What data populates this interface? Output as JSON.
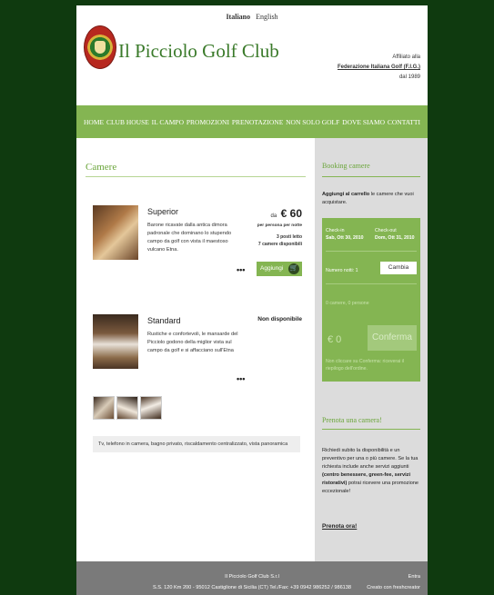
{
  "header": {
    "languages": [
      {
        "label": "Italiano",
        "active": true
      },
      {
        "label": "English",
        "active": false
      }
    ],
    "club_name": "Il Picciolo Golf Club",
    "affiliation_line1": "Affiliato alla",
    "affiliation_federation": "Federazione Italiana Golf  (F.I.G.)",
    "affiliation_since": "dal 1989"
  },
  "nav": {
    "items": [
      {
        "label": "HOME"
      },
      {
        "label": "CLUB HOUSE"
      },
      {
        "label": "IL CAMPO"
      },
      {
        "label": "PROMOZIONI"
      },
      {
        "label": "PRENOTAZIONE"
      },
      {
        "label": "NON SOLO GOLF"
      },
      {
        "label": "DOVE SIAMO"
      },
      {
        "label": "CONTATTI"
      }
    ]
  },
  "main": {
    "section_title": "Camere",
    "rooms": [
      {
        "name": "Superior",
        "description": "Barone ricavate dalla antica dimora padronale che dominano lo stupendo campo da golf con vista il maestoso vulcano Etna.",
        "more": "•••",
        "price_from": "da",
        "price_value": "€ 60",
        "price_basis": "per persona per notte",
        "beds": "3 posti letto",
        "available": "7 camere disponibili",
        "add_label": "Aggiungi",
        "cart_icon": "cart-icon"
      },
      {
        "name": "Standard",
        "description": "Rustiche e confortevoli, le mansarde del Picciolo godono della miglior vista sul campo da golf e si affacciano sull'Etna",
        "more": "•••",
        "unavailable": "Non disponibile"
      }
    ],
    "amenities": "Tv, telefono in camera, bagno privato, riscaldamento centralizzato, vista panoramica"
  },
  "sidebar": {
    "booking_title": "Booking camere",
    "booking_intro_bold": "Aggiungi al carrello",
    "booking_intro_rest": " le camere che vuoi acquistare.",
    "checkin_label": "Check-in",
    "checkin_value": "Sab, Ott 30, 2010",
    "checkout_label": "Check-out",
    "checkout_value": "Dom, Ott 31, 2010",
    "nights_label": "Numero notti: 1",
    "change_label": "Cambia",
    "people_text": "0 camere, 0 persone",
    "total": "€ 0",
    "confirm_label": "Conferma",
    "confirm_note": "Non cliccare su Conferma: riceverai il riepilogo dell'ordine.",
    "reserve_title": "Prenota una camera!",
    "reserve_text_1": "Richiedi subito la disponibilità e un preventivo per una o più camere. Se la tua richiesta include anche servizi aggiunti ",
    "reserve_text_bold": "(centro benessere, green-fee, servizi ristorativi)",
    "reserve_text_2": " potrai ricevere una promozione eccezionale!",
    "reserve_link": "Prenota ora!"
  },
  "footer": {
    "company": "Il Picciolo Golf Club S.r.l",
    "address": "S.S. 120 Km 200 - 95012 Castiglione di Sicilia (CT) Tel./Fax: +39 0942 986252 / 986138",
    "login": "Entra",
    "credit": "Creato con freshcreator"
  },
  "colors": {
    "accent": "#84b552",
    "title_green": "#6aa53a",
    "background": "#0f3a0f",
    "footer": "#7a7a7a",
    "sidebar": "#dcdcdc"
  }
}
